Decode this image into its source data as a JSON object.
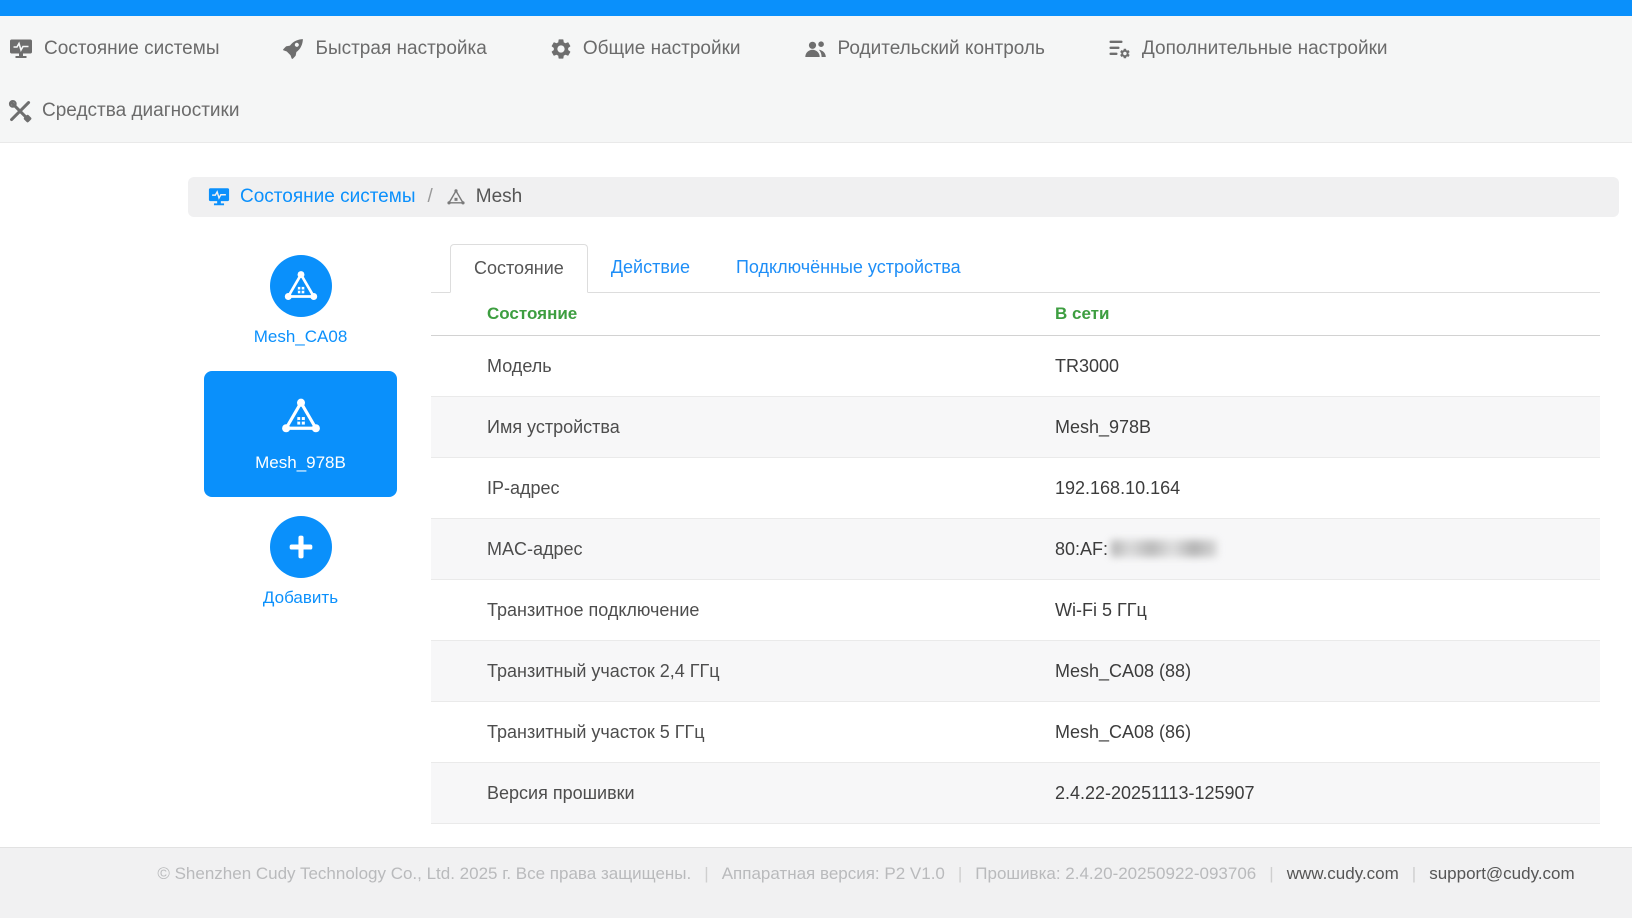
{
  "colors": {
    "accent_blue": "#0a90fb",
    "status_green": "#3d9e40"
  },
  "topnav": {
    "items": [
      {
        "label": "Состояние системы",
        "icon": "monitor-pulse-icon"
      },
      {
        "label": "Быстрая настройка",
        "icon": "rocket-icon"
      },
      {
        "label": "Общие настройки",
        "icon": "gear-icon"
      },
      {
        "label": "Родительский контроль",
        "icon": "users-icon"
      },
      {
        "label": "Дополнительные настройки",
        "icon": "list-gear-icon"
      },
      {
        "label": "Средства диагностики",
        "icon": "tools-icon"
      }
    ]
  },
  "breadcrumb": {
    "section": "Состояние системы",
    "separator": "/",
    "page": "Mesh"
  },
  "sidebar": {
    "nodes": [
      {
        "label": "Mesh_CA08",
        "selected": false
      },
      {
        "label": "Mesh_978B",
        "selected": true
      }
    ],
    "add_label": "Добавить"
  },
  "tabs": [
    {
      "label": "Состояние",
      "active": true
    },
    {
      "label": "Действие",
      "active": false
    },
    {
      "label": "Подключённые устройства",
      "active": false
    }
  ],
  "status_table": {
    "header": {
      "left": "Состояние",
      "right": "В сети"
    },
    "rows": [
      {
        "label": "Модель",
        "value": "TR3000"
      },
      {
        "label": "Имя устройства",
        "value": "Mesh_978B"
      },
      {
        "label": "IP-адрес",
        "value": "192.168.10.164"
      },
      {
        "label": "MAC-адрес",
        "value": "80:AF:",
        "redacted": true
      },
      {
        "label": "Транзитное подключение",
        "value": "Wi-Fi 5 ГГц"
      },
      {
        "label": "Транзитный участок 2,4 ГГц",
        "value": "Mesh_CA08 (88)"
      },
      {
        "label": "Транзитный участок 5 ГГц",
        "value": "Mesh_CA08 (86)"
      },
      {
        "label": "Версия прошивки",
        "value": "2.4.22-20251113-125907"
      }
    ]
  },
  "footer": {
    "copyright": "© Shenzhen Cudy Technology Co., Ltd. 2025 г. Все права защищены.",
    "hardware": "Аппаратная версия: P2 V1.0",
    "firmware": "Прошивка: 2.4.20-20250922-093706",
    "website": "www.cudy.com",
    "email": "support@cudy.com",
    "separator": "|"
  }
}
